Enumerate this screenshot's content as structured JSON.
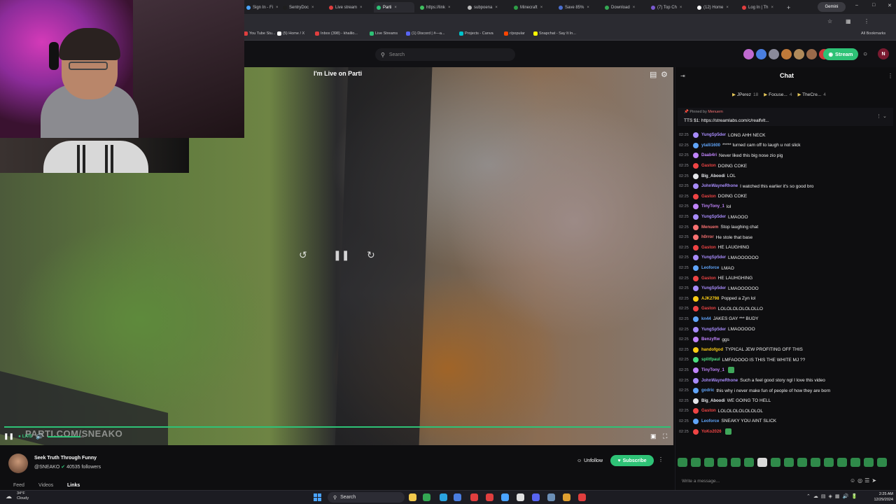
{
  "browser": {
    "tabs": [
      {
        "label": "Sign In - Fi",
        "color": "#4aa3ff"
      },
      {
        "label": "SentryDoc",
        "color": "#1e1e1e"
      },
      {
        "label": "Live stream",
        "color": "#e03e3e"
      },
      {
        "label": "Parti",
        "color": "#2ec276",
        "active": true
      },
      {
        "label": "https://link",
        "color": "#3fbf5f"
      },
      {
        "label": "subpoena",
        "color": "#bbbbbb"
      },
      {
        "label": "Minecraft",
        "color": "#2e9e46"
      },
      {
        "label": "Save 85%",
        "color": "#4a6fd0"
      },
      {
        "label": "Download",
        "color": "#34a853"
      },
      {
        "label": "(7) Top Ch",
        "color": "#7a5ad0"
      },
      {
        "label": "(12) Home",
        "color": "#ffffff"
      },
      {
        "label": "Log In | Th",
        "color": "#e03e3e"
      }
    ],
    "gemini_label": "Gemini",
    "bookmarks": [
      {
        "label": "You Tube Stu...",
        "color": "#e03e3e"
      },
      {
        "label": "(5) Home / X",
        "color": "#ffffff"
      },
      {
        "label": "Inbox (398) - khalilo...",
        "color": "#e03e3e"
      },
      {
        "label": "Live Streams",
        "color": "#2ec276"
      },
      {
        "label": "(1) Discord | #—a...",
        "color": "#5865f2"
      },
      {
        "label": "Projects - Canva",
        "color": "#00c4cc"
      },
      {
        "label": "r/popular",
        "color": "#ff4500"
      },
      {
        "label": "Snapchat - Say It In...",
        "color": "#fffc00"
      }
    ],
    "all_bookmarks": "All Bookmarks"
  },
  "header": {
    "search_placeholder": "Search",
    "stream_label": "Stream",
    "user_initial": "N",
    "avatar_colors": [
      "#c06ad0",
      "#4a7ee0",
      "#8a8a9a",
      "#c07a3a",
      "#b08a5a",
      "#9a6a4a",
      "#d03a3a"
    ]
  },
  "video": {
    "title": "I'm Live on Parti",
    "watermark": "PARTI.COM/SNEAKO",
    "live_label": "LIVE",
    "progress": 1.0,
    "volume": 0.9
  },
  "channel": {
    "title": "Seek Truth Through Funny",
    "handle": "@SNEAKO",
    "followers": "40535 followers",
    "unfollow_label": "Unfollow",
    "subscribe_label": "Subscribe",
    "tabs": [
      "Feed",
      "Videos",
      "Links"
    ],
    "active_tab": "Links"
  },
  "chat": {
    "title": "Chat",
    "top_supporters": [
      {
        "name": "JPerez",
        "count": "18"
      },
      {
        "name": "Focuse...",
        "count": "4"
      },
      {
        "name": "TheCre...",
        "count": "4"
      }
    ],
    "pinned_by": "Pinned by",
    "pinned_user": "Menuem",
    "pinned_message": "TTS $1: https://streamlabs.com/c/realfvlt...",
    "messages": [
      {
        "ts": "02:25",
        "user": "YungSp5der",
        "color": "#a78bfa",
        "text": "LONG AHH NECK",
        "emote": false
      },
      {
        "ts": "02:25",
        "user": "ytalli1600",
        "color": "#60a5fa",
        "text": "***** turned cam off to laugh u not slick",
        "emote": false
      },
      {
        "ts": "02:25",
        "user": "Daab4ri",
        "color": "#c084fc",
        "text": "Never liked this big nose zio pig",
        "emote": false
      },
      {
        "ts": "02:25",
        "user": "Gaston",
        "color": "#ef4444",
        "text": "DOING COKE",
        "emote": false
      },
      {
        "ts": "02:25",
        "user": "Big_Aboodi",
        "color": "#e5e7eb",
        "text": "LOL",
        "emote": false
      },
      {
        "ts": "02:25",
        "user": "JohnWayneRhone",
        "color": "#a78bfa",
        "text": "I watched this earlier it's so good bro",
        "emote": false
      },
      {
        "ts": "02:25",
        "user": "Gaston",
        "color": "#ef4444",
        "text": "DOING COKE",
        "emote": false
      },
      {
        "ts": "02:25",
        "user": "TinyTony_1",
        "color": "#c084fc",
        "text": "lol",
        "emote": false
      },
      {
        "ts": "02:25",
        "user": "YungSp5der",
        "color": "#a78bfa",
        "text": "LMAOOO",
        "emote": false
      },
      {
        "ts": "02:25",
        "user": "Menuem",
        "color": "#f87171",
        "text": "Stop laughing chat",
        "emote": false
      },
      {
        "ts": "02:25",
        "user": "h0rror",
        "color": "#f87171",
        "text": "He stole that base",
        "emote": false
      },
      {
        "ts": "02:25",
        "user": "Gaston",
        "color": "#ef4444",
        "text": "HE LAUGHING",
        "emote": false
      },
      {
        "ts": "02:25",
        "user": "YungSp5der",
        "color": "#a78bfa",
        "text": "LMAOOOOOO",
        "emote": false
      },
      {
        "ts": "02:25",
        "user": "Leoforce",
        "color": "#60a5fa",
        "text": "LMAO",
        "emote": false
      },
      {
        "ts": "02:25",
        "user": "Gaston",
        "color": "#ef4444",
        "text": "HE LAUHGHING",
        "emote": false
      },
      {
        "ts": "02:25",
        "user": "YungSp5der",
        "color": "#a78bfa",
        "text": "LMAOOOOOO",
        "emote": false
      },
      {
        "ts": "02:25",
        "user": "AJK2798",
        "color": "#facc15",
        "text": "Popped a Zyn lol",
        "emote": false
      },
      {
        "ts": "02:25",
        "user": "Gaston",
        "color": "#ef4444",
        "text": "LOLOLOLOLOLOLLO",
        "emote": false
      },
      {
        "ts": "02:25",
        "user": "kn44",
        "color": "#60a5fa",
        "text": "JAKES GAY *** BUDY",
        "emote": false
      },
      {
        "ts": "02:25",
        "user": "YungSp5der",
        "color": "#a78bfa",
        "text": "LMAOOOOO",
        "emote": false
      },
      {
        "ts": "02:25",
        "user": "Benzyftw",
        "color": "#c084fc",
        "text": "ggs",
        "emote": false
      },
      {
        "ts": "02:25",
        "user": "handofgod",
        "color": "#facc15",
        "text": "TYPICAL JEW PROFITING OFF THIS",
        "emote": false
      },
      {
        "ts": "02:25",
        "user": "splitfpaul",
        "color": "#4ade80",
        "text": "LMFAOOOO IS THIS THE WHITE MJ ??",
        "emote": false
      },
      {
        "ts": "02:25",
        "user": "TinyTony_1",
        "color": "#c084fc",
        "text": "",
        "emote": true
      },
      {
        "ts": "02:25",
        "user": "JohnWayneRhone",
        "color": "#a78bfa",
        "text": "Such a feel good story ngl I love this video",
        "emote": false
      },
      {
        "ts": "02:25",
        "user": "godric",
        "color": "#60a5fa",
        "text": "this why i never make fun of people of how they are born",
        "emote": false
      },
      {
        "ts": "02:25",
        "user": "Big_Aboodi",
        "color": "#e5e7eb",
        "text": "WE GOING TO HELL",
        "emote": false
      },
      {
        "ts": "02:25",
        "user": "Gaston",
        "color": "#ef4444",
        "text": "LOLOLOLOLOLOLOL",
        "emote": false
      },
      {
        "ts": "02:25",
        "user": "Leoforce",
        "color": "#60a5fa",
        "text": "SNEAKY YOU AINT SLICK",
        "emote": false
      },
      {
        "ts": "02:25",
        "user": "YoKo2026",
        "color": "#ef4444",
        "text": "",
        "emote": true
      }
    ],
    "input_placeholder": "Write a message..."
  },
  "taskbar": {
    "weather_temp": "34°F",
    "weather_desc": "Cloudy",
    "search_label": "Search",
    "time": "2:25 AM",
    "date": "12/29/2024"
  }
}
